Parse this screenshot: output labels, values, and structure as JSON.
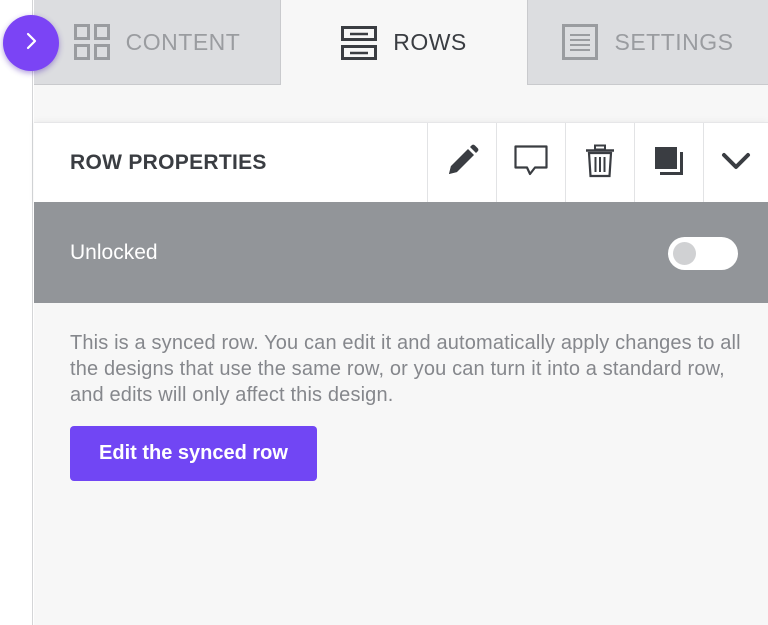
{
  "tabs": [
    {
      "label": "CONTENT",
      "icon": "grid-icon",
      "active": false
    },
    {
      "label": "ROWS",
      "icon": "rows-icon",
      "active": true
    },
    {
      "label": "SETTINGS",
      "icon": "settings-icon",
      "active": false
    }
  ],
  "row_properties": {
    "title": "ROW PROPERTIES",
    "actions": [
      "pencil-icon",
      "comment-icon",
      "trash-icon",
      "duplicate-icon",
      "chevron-down-icon"
    ]
  },
  "lock": {
    "label": "Unlocked",
    "toggle_on": false
  },
  "synced": {
    "description": "This is a synced row. You can edit it and automatically apply changes to all the designs that use the same row, or you can turn it into a standard row, and edits will only affect this design.",
    "button_label": "Edit the synced row"
  },
  "colors": {
    "accent": "#7146f4",
    "lock_bar": "#929599",
    "tab_inactive": "#dcdde0"
  }
}
